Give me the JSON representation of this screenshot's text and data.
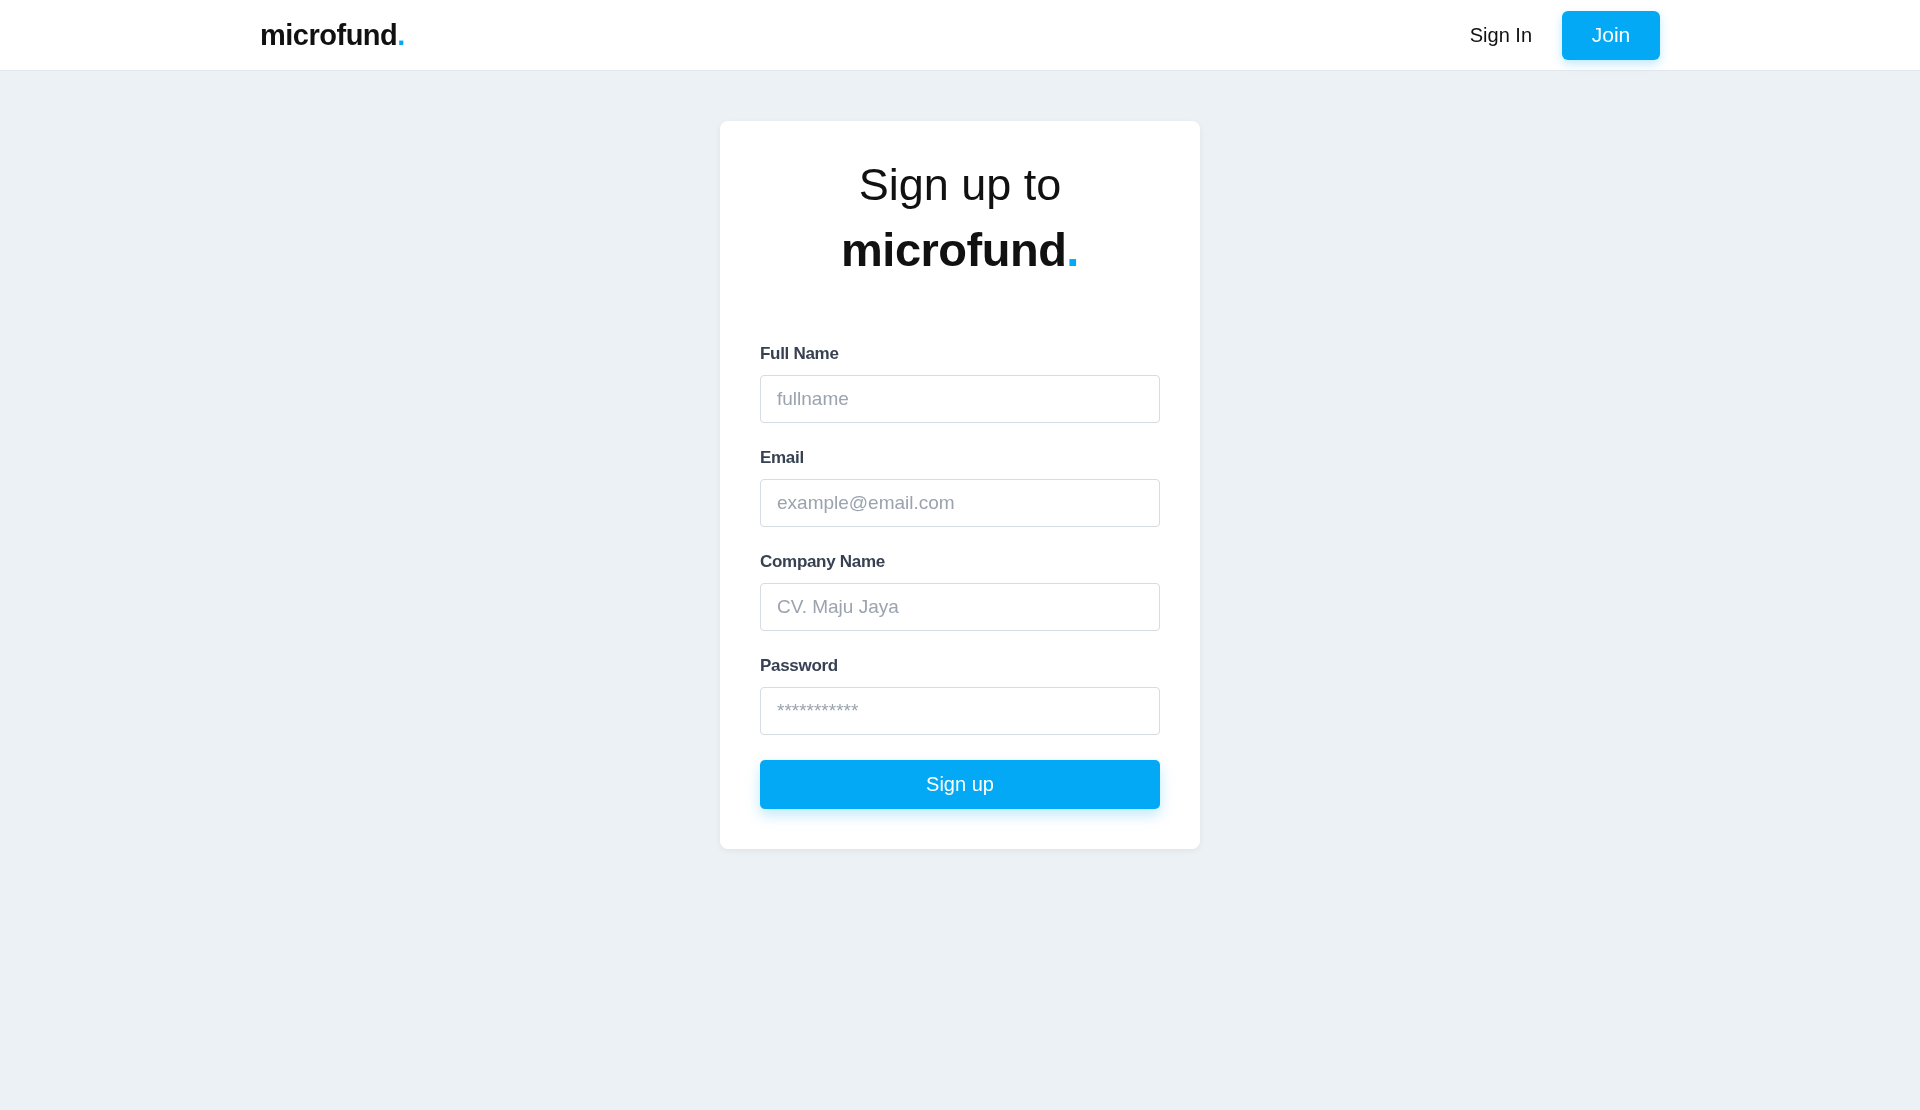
{
  "header": {
    "logo": {
      "name": "microfund",
      "dot": "."
    },
    "nav": [
      {
        "label": "Sign In",
        "kind": "link"
      },
      {
        "label": "Join",
        "kind": "button"
      }
    ]
  },
  "card": {
    "title": "Sign up to",
    "brand": {
      "name": "microfund",
      "dot": "."
    },
    "fields": [
      {
        "label": "Full Name",
        "placeholder": "fullname"
      },
      {
        "label": "Email",
        "placeholder": "example@email.com"
      },
      {
        "label": "Company Name",
        "placeholder": "CV. Maju Jaya"
      },
      {
        "label": "Password",
        "placeholder": "***********"
      }
    ],
    "submit": "Sign up"
  }
}
